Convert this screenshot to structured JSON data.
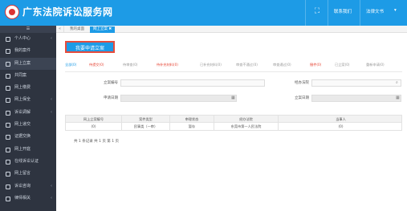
{
  "header": {
    "title": "广东法院诉讼服务网",
    "links": [
      "联系我们",
      "法律文书"
    ]
  },
  "sidebar": {
    "head": "☰",
    "items": [
      {
        "label": "个人中心",
        "arrow": "‹"
      },
      {
        "label": "我的案件",
        "arrow": ""
      },
      {
        "label": "网上立案",
        "arrow": "",
        "active": true
      },
      {
        "label": "共同案",
        "arrow": ""
      },
      {
        "label": "网上缴费",
        "arrow": ""
      },
      {
        "label": "网上保全",
        "arrow": "‹"
      },
      {
        "label": "诉讼调解",
        "arrow": "‹"
      },
      {
        "label": "网上递交",
        "arrow": ""
      },
      {
        "label": "证据交换",
        "arrow": ""
      },
      {
        "label": "网上开庭",
        "arrow": ""
      },
      {
        "label": "在线诉讼认证",
        "arrow": ""
      },
      {
        "label": "网上留言",
        "arrow": ""
      },
      {
        "label": "诉讼咨询",
        "arrow": "‹"
      },
      {
        "label": "律师相关",
        "arrow": "‹"
      }
    ]
  },
  "tabs": [
    {
      "label": "我的桌面",
      "active": false
    },
    {
      "label": "网上立案 ✖",
      "active": true
    }
  ],
  "apply_button": "我要申请立案",
  "filters": [
    {
      "label": "全部(0)",
      "color": "#1d9be6"
    },
    {
      "label": "待提交(0)",
      "color": "#e74c3c"
    },
    {
      "label": "待审查(0)",
      "color": "#999999"
    },
    {
      "label": "待补充材料(0)",
      "color": "#e74c3c"
    },
    {
      "label": "已补充材料(0)",
      "color": "#999999"
    },
    {
      "label": "审查不通过(0)",
      "color": "#999999"
    },
    {
      "label": "审查通过(0)",
      "color": "#999999"
    },
    {
      "label": "撤件(0)",
      "color": "#e74c3c"
    },
    {
      "label": "已立案(0)",
      "color": "#999999"
    },
    {
      "label": "重新申请(0)",
      "color": "#999999"
    }
  ],
  "form": {
    "case_no_label": "立案编号",
    "court_label": "经办法院",
    "apply_date_label": "申请日期",
    "submit_date_label": "立案日期"
  },
  "table": {
    "headers": [
      "网上立案编号",
      "案件类型",
      "审理状态",
      "经办法院",
      "当事人"
    ],
    "rows": [
      [
        "(0)",
        "民事类（一审）",
        "暂存",
        "东莞市第一人民法院",
        "(0)"
      ]
    ]
  },
  "pager": "共 1 条记录  共 1 页  第 1 页"
}
